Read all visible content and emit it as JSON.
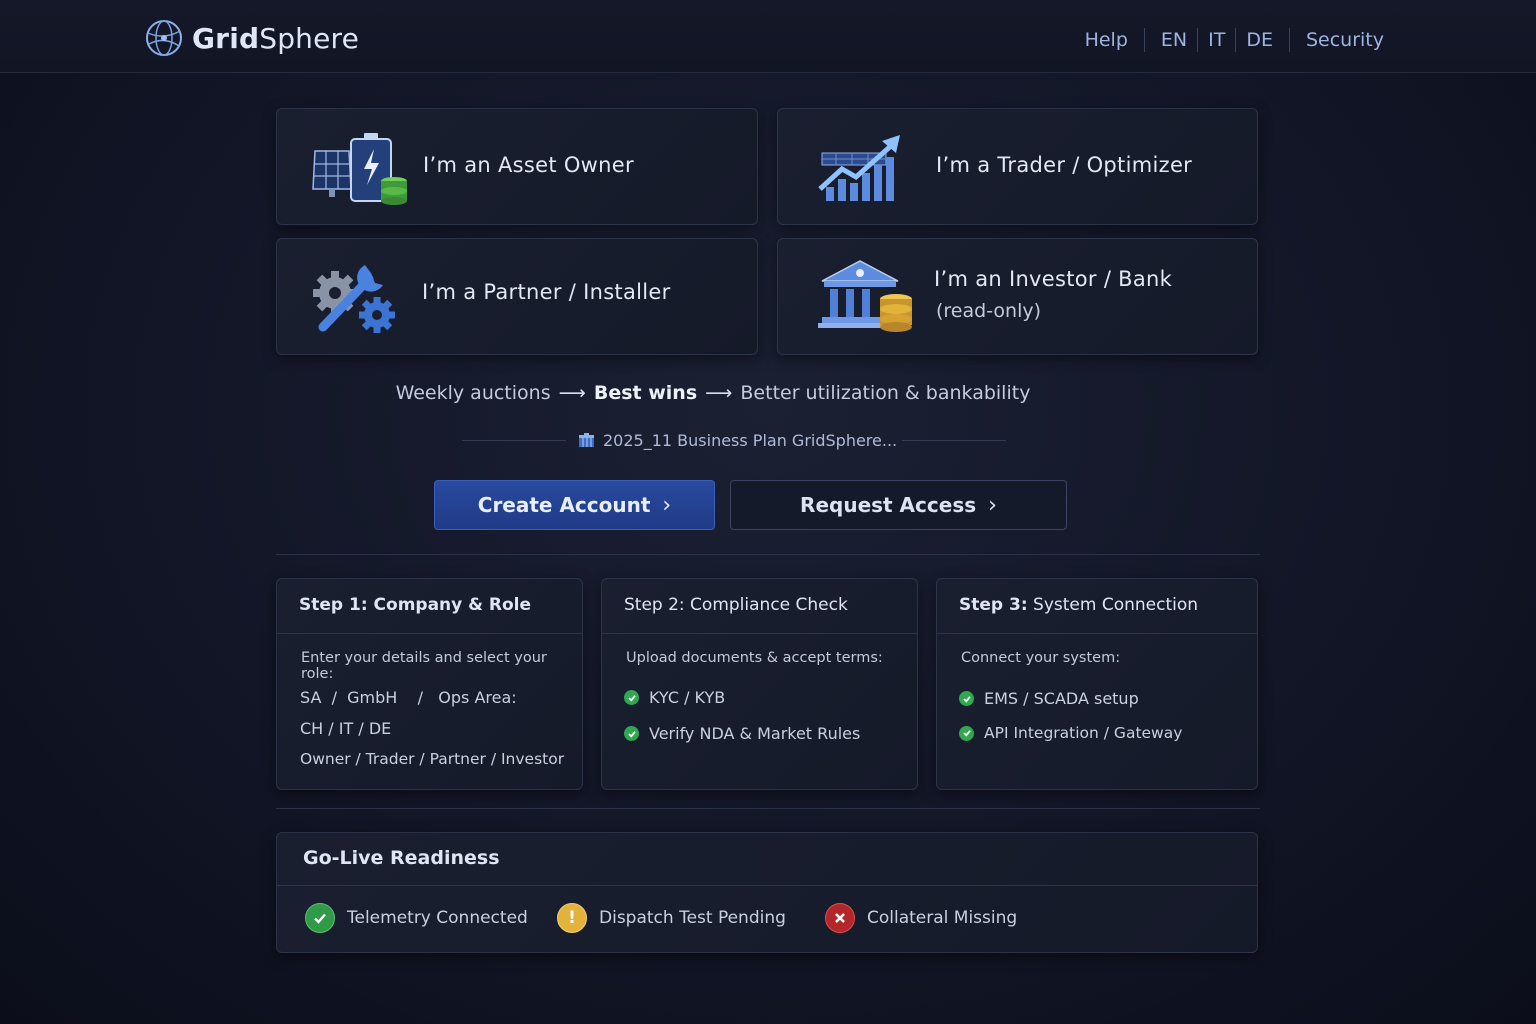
{
  "brand": {
    "name_bold": "Grid",
    "name_light": "Sphere"
  },
  "nav": {
    "help": "Help",
    "lang_en": "EN",
    "lang_it": "IT",
    "lang_de": "DE",
    "security": "Security"
  },
  "roles": {
    "asset_owner": "I’m an Asset Owner",
    "trader": "I’m a Trader / Optimizer",
    "partner": "I’m a Partner / Installer",
    "investor": "I’m an Investor / Bank",
    "investor_sub": "(read-only)"
  },
  "tagline": {
    "part1": "Weekly auctions",
    "part2": "Best wins",
    "part3": "Better utilization & bankability"
  },
  "plan_link": "2025_11 Business Plan GridSphere...",
  "buttons": {
    "create": "Create Account",
    "request": "Request Access"
  },
  "steps": {
    "step1": {
      "prefix": "Step 1: Company & Role",
      "desc": "Enter your details and select your role:",
      "line1": "SA  /  GmbH    /   Ops Area:",
      "line2": "CH / IT / DE",
      "line3": "Owner / Trader / Partner / Investor"
    },
    "step2": {
      "title": "Step 2: Compliance Check",
      "desc": "Upload documents & accept terms:",
      "item1": "KYC / KYB",
      "item2": "Verify NDA & Market Rules"
    },
    "step3": {
      "bold": "Step 3:",
      "rest": " System Connection",
      "desc": "Connect your system:",
      "item1": "EMS / SCADA setup",
      "item2": "API Integration / Gateway"
    }
  },
  "readiness": {
    "title": "Go-Live Readiness",
    "telemetry": "Telemetry Connected",
    "dispatch": "Dispatch Test Pending",
    "collateral": "Collateral Missing"
  },
  "colors": {
    "accent": "#2a4aa0",
    "ok": "#2fa84f",
    "warn": "#e2b23a",
    "error": "#c0282c"
  }
}
